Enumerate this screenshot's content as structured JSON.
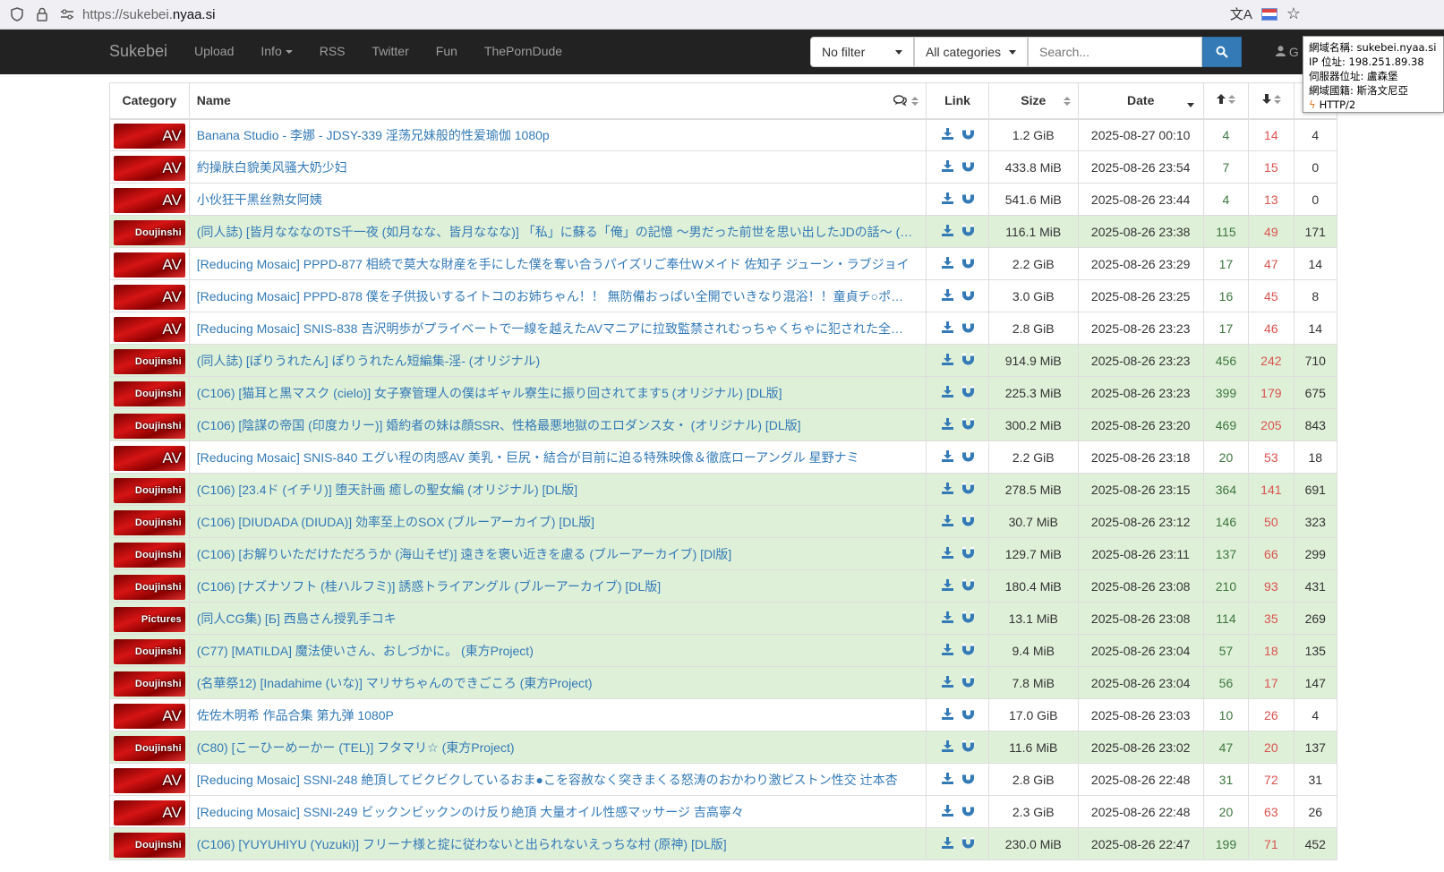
{
  "browser": {
    "url_prefix": "https://sukebei.",
    "url_host": "nyaa.si"
  },
  "navbar": {
    "brand": "Sukebei",
    "items": [
      "Upload",
      "Info",
      "RSS",
      "Twitter",
      "Fun",
      "ThePornDude"
    ],
    "filter_value": "No filter",
    "category_value": "All categories",
    "search_placeholder": "Search...",
    "user_label": "G"
  },
  "popup": {
    "line1": "網域名稱: sukebei.nyaa.si",
    "line2": "IP 位址: 198.251.89.38",
    "line3": "伺服器位址: 盧森堡",
    "line4": "網域國籍: 斯洛文尼亞",
    "line5": "HTTP/2"
  },
  "table": {
    "headers": {
      "category": "Category",
      "name": "Name",
      "link": "Link",
      "size": "Size",
      "date": "Date"
    },
    "rows": [
      {
        "cat": "AV",
        "name": "Banana Studio - 李娜 - JDSY-339 淫荡兄妹般的性爱瑜伽 1080p",
        "size": "1.2 GiB",
        "date": "2025-08-27 00:10",
        "se": "4",
        "le": "14",
        "dl": "4",
        "trusted": false
      },
      {
        "cat": "AV",
        "name": "約操肤白貌美风骚大奶少妇",
        "size": "433.8 MiB",
        "date": "2025-08-26 23:54",
        "se": "7",
        "le": "15",
        "dl": "0",
        "trusted": false
      },
      {
        "cat": "AV",
        "name": "小伙狂干黑丝熟女阿姨",
        "size": "541.6 MiB",
        "date": "2025-08-26 23:44",
        "se": "4",
        "le": "13",
        "dl": "0",
        "trusted": false
      },
      {
        "cat": "Doujinshi",
        "name": "(同人誌) [皆月なななのTS千一夜 (如月なな、皆月ななな)] 「私」に蘇る「俺」の記憶 ～男だった前世を思い出したJDの話～ (…",
        "size": "116.1 MiB",
        "date": "2025-08-26 23:38",
        "se": "115",
        "le": "49",
        "dl": "171",
        "trusted": true
      },
      {
        "cat": "AV",
        "name": "[Reducing Mosaic] PPPD-877 相続で莫大な財産を手にした僕を奪い合うパイズリご奉仕Wメイド 佐知子 ジューン・ラブジョイ",
        "size": "2.2 GiB",
        "date": "2025-08-26 23:29",
        "se": "17",
        "le": "47",
        "dl": "14",
        "trusted": false
      },
      {
        "cat": "AV",
        "name": "[Reducing Mosaic] PPPD-878 僕を子供扱いするイトコのお姉ちゃん！！ 無防備おっぱい全開でいきなり混浴！！童貞チ○ポ…",
        "size": "3.0 GiB",
        "date": "2025-08-26 23:25",
        "se": "16",
        "le": "45",
        "dl": "8",
        "trusted": false
      },
      {
        "cat": "AV",
        "name": "[Reducing Mosaic] SNIS-838 吉沢明歩がプライベートで一線を越えたAVマニアに拉致監禁されむっちゃくちゃに犯された全…",
        "size": "2.8 GiB",
        "date": "2025-08-26 23:23",
        "se": "17",
        "le": "46",
        "dl": "14",
        "trusted": false
      },
      {
        "cat": "Doujinshi",
        "name": "(同人誌) [ぽりうれたん] ぽりうれたん短編集-淫- (オリジナル)",
        "size": "914.9 MiB",
        "date": "2025-08-26 23:23",
        "se": "456",
        "le": "242",
        "dl": "710",
        "trusted": true
      },
      {
        "cat": "Doujinshi",
        "name": "(C106) [猫耳と黒マスク (cielo)] 女子寮管理人の僕はギャル寮生に振り回されてます5 (オリジナル) [DL版]",
        "size": "225.3 MiB",
        "date": "2025-08-26 23:23",
        "se": "399",
        "le": "179",
        "dl": "675",
        "trusted": true
      },
      {
        "cat": "Doujinshi",
        "name": "(C106) [陰謀の帝国 (印度カリー)] 婚約者の妹は顔SSR、性格最悪地獄のエロダンス女・ (オリジナル) [DL版]",
        "size": "300.2 MiB",
        "date": "2025-08-26 23:20",
        "se": "469",
        "le": "205",
        "dl": "843",
        "trusted": true
      },
      {
        "cat": "AV",
        "name": "[Reducing Mosaic] SNIS-840 エグい程の肉感AV 美乳・巨尻・結合が目前に迫る特殊映像＆徹底ローアングル 星野ナミ",
        "size": "2.2 GiB",
        "date": "2025-08-26 23:18",
        "se": "20",
        "le": "53",
        "dl": "18",
        "trusted": false
      },
      {
        "cat": "Doujinshi",
        "name": "(C106) [23.4ド (イチリ)] 堕天計画 癒しの聖女編 (オリジナル) [DL版]",
        "size": "278.5 MiB",
        "date": "2025-08-26 23:15",
        "se": "364",
        "le": "141",
        "dl": "691",
        "trusted": true
      },
      {
        "cat": "Doujinshi",
        "name": "(C106) [DIUDADA (DIUDA)] 効率至上のSOX (ブルーアーカイブ) [DL版]",
        "size": "30.7 MiB",
        "date": "2025-08-26 23:12",
        "se": "146",
        "le": "50",
        "dl": "323",
        "trusted": true
      },
      {
        "cat": "Doujinshi",
        "name": "(C106) [お解りいただけただろうか (海山そぜ)] 遠きを褒い近きを慮る (ブルーアーカイブ) [Dl版]",
        "size": "129.7 MiB",
        "date": "2025-08-26 23:11",
        "se": "137",
        "le": "66",
        "dl": "299",
        "trusted": true
      },
      {
        "cat": "Doujinshi",
        "name": "(C106) [ナズナソフト (桂ハルフミ)] 誘惑トライアングル (ブルーアーカイブ) [DL版]",
        "size": "180.4 MiB",
        "date": "2025-08-26 23:08",
        "se": "210",
        "le": "93",
        "dl": "431",
        "trusted": true
      },
      {
        "cat": "Pictures",
        "name": "(同人CG集) [Б] 西島さん授乳手コキ",
        "size": "13.1 MiB",
        "date": "2025-08-26 23:08",
        "se": "114",
        "le": "35",
        "dl": "269",
        "trusted": true
      },
      {
        "cat": "Doujinshi",
        "name": "(C77) [MATILDA] 魔法使いさん、おしづかに。 (東方Project)",
        "size": "9.4 MiB",
        "date": "2025-08-26 23:04",
        "se": "57",
        "le": "18",
        "dl": "135",
        "trusted": true
      },
      {
        "cat": "Doujinshi",
        "name": "(名華祭12) [Inadahime (いな)] マリサちゃんのできごころ (東方Project)",
        "size": "7.8 MiB",
        "date": "2025-08-26 23:04",
        "se": "56",
        "le": "17",
        "dl": "147",
        "trusted": true
      },
      {
        "cat": "AV",
        "name": "佐佐木明希 作品合集 第九弹 1080P",
        "size": "17.0 GiB",
        "date": "2025-08-26 23:03",
        "se": "10",
        "le": "26",
        "dl": "4",
        "trusted": false
      },
      {
        "cat": "Doujinshi",
        "name": "(C80) [こーひーめーかー (TEL)] フタマリ☆ (東方Project)",
        "size": "11.6 MiB",
        "date": "2025-08-26 23:02",
        "se": "47",
        "le": "20",
        "dl": "137",
        "trusted": true
      },
      {
        "cat": "AV",
        "name": "[Reducing Mosaic] SSNI-248 絶頂してビクビクしているおま●こを容赦なく突きまくる怒涛のおかわり激ピストン性交 辻本杏",
        "size": "2.8 GiB",
        "date": "2025-08-26 22:48",
        "se": "31",
        "le": "72",
        "dl": "31",
        "trusted": false
      },
      {
        "cat": "AV",
        "name": "[Reducing Mosaic] SSNI-249 ビックンビックンのけ反り絶頂 大量オイル性感マッサージ 吉高寧々",
        "size": "2.3 GiB",
        "date": "2025-08-26 22:48",
        "se": "20",
        "le": "63",
        "dl": "26",
        "trusted": false
      },
      {
        "cat": "Doujinshi",
        "name": "(C106) [YUYUHIYU (Yuzuki)] フリーナ様と掟に従わないと出られないえっちな村 (原神) [DL版]",
        "size": "230.0 MiB",
        "date": "2025-08-26 22:47",
        "se": "199",
        "le": "71",
        "dl": "452",
        "trusted": true
      }
    ]
  }
}
